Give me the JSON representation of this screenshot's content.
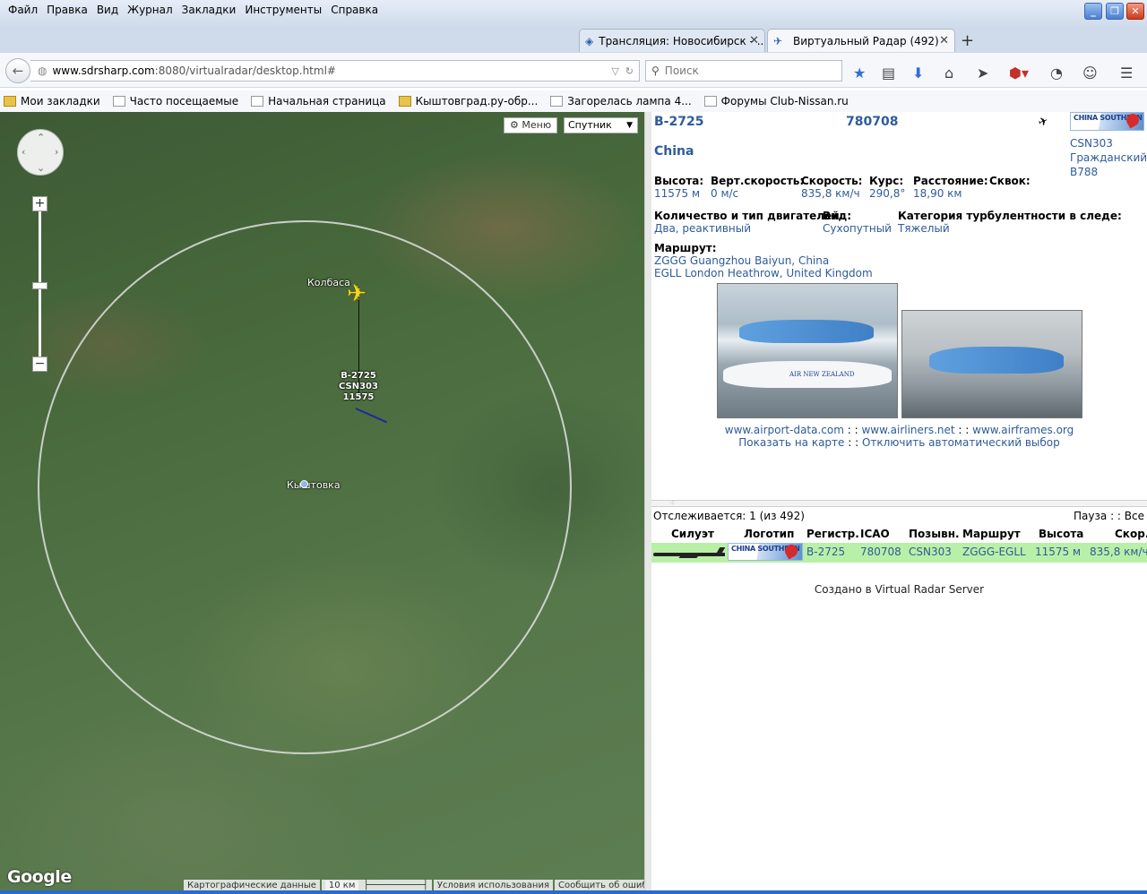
{
  "menu": [
    "Файл",
    "Правка",
    "Вид",
    "Журнал",
    "Закладки",
    "Инструменты",
    "Справка"
  ],
  "tabs": [
    {
      "title": "Трансляция: Новосибирск - ...",
      "icon": "broadcast-icon",
      "active": false
    },
    {
      "title": "Виртуальный Радар (492)",
      "icon": "plane-icon",
      "active": true
    }
  ],
  "nav": {
    "url_host": "www.sdrsharp.com",
    "url_rest": ":8080/virtualradar/desktop.html#",
    "search_placeholder": "Поиск"
  },
  "bookmarks": [
    {
      "label": "Мои закладки",
      "icon": "folder"
    },
    {
      "label": "Часто посещаемые",
      "icon": "page"
    },
    {
      "label": "Начальная страница",
      "icon": "page"
    },
    {
      "label": "Кыштовград.ру-обр...",
      "icon": "page"
    },
    {
      "label": "Загорелась лампа 4...",
      "icon": "page"
    },
    {
      "label": "Форумы Club-Nissan.ru",
      "icon": "page"
    }
  ],
  "map": {
    "menu_label": "Меню",
    "type_label": "Спутник",
    "label_kolbasa": "Колбаса",
    "label_kyshtovka": "Кыштовка",
    "flight_label_reg": "B-2725",
    "flight_label_callsign": "CSN303",
    "flight_label_altitude": "11575",
    "google": "Google",
    "footer": [
      "Картографические данные",
      "10 км",
      "Условия использования",
      "Сообщить об ошибке на карте"
    ]
  },
  "detail": {
    "registration": "B-2725",
    "icao": "780708",
    "country": "China",
    "logo_text": "CHINA SOUTHERN",
    "callsign": "CSN303",
    "species": "Гражданский",
    "type": "B788",
    "fields": [
      {
        "label": "Высота:",
        "value": "11575 м"
      },
      {
        "label": "Верт.скорость:",
        "value": "0 м/с"
      },
      {
        "label": "Скорость:",
        "value": "835,8 км/ч"
      },
      {
        "label": "Курс:",
        "value": "290,8°"
      },
      {
        "label": "Расстояние:",
        "value": "18,90 км"
      },
      {
        "label": "Сквок:",
        "value": ""
      }
    ],
    "engines_label": "Количество и тип двигателей:",
    "engines_value": "Два, реактивный",
    "kind_label": "Вид:",
    "kind_value": "Сухопутный",
    "wtc_label": "Категория турбулентности в следе:",
    "wtc_value": "Тяжелый",
    "route_label": "Маршрут:",
    "route_from": "ZGGG Guangzhou Baiyun, China",
    "route_to": "EGLL London Heathrow, United Kingdom",
    "photo_text": "AIR NEW ZEALAND",
    "links": [
      "www.airport-data.com",
      "www.airliners.net",
      "www.airframes.org"
    ],
    "link_sep": " : : ",
    "show_on_map": "Показать на карте",
    "disable_autoselect": "Отключить автоматический выбор"
  },
  "list": {
    "tracking_text": "Отслеживается: 1 (из 492)",
    "pause": "Пауза",
    "all": "Все",
    "headers": [
      "Силуэт",
      "Логотип",
      "Регистр.",
      "ICAO",
      "Позывн.",
      "Маршрут",
      "Высота",
      "Скор."
    ],
    "row": {
      "registration": "B-2725",
      "icao": "780708",
      "callsign": "CSN303",
      "route": "ZGGG-EGLL",
      "altitude": "11575 м",
      "speed": "835,8 км/ч"
    },
    "credit": "Создано в Virtual Radar Server"
  },
  "colors": {
    "value_blue": "#2e5b9a",
    "row_highlight": "#b9f0a7",
    "plane_yellow": "#f6d51b"
  }
}
